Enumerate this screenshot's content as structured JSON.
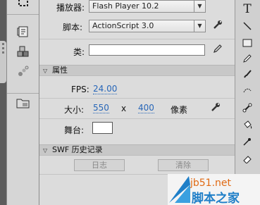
{
  "properties": {
    "player_label": "播放器:",
    "player_value": "Flash Player 10.2",
    "script_label": "脚本:",
    "script_value": "ActionScript 3.0",
    "class_label": "类:",
    "class_value": "",
    "section_properties": "属性",
    "fps_label": "FPS:",
    "fps_value": "24.00",
    "size_label": "大小:",
    "width_value": "550",
    "size_x": "x",
    "height_value": "400",
    "size_unit": "像素",
    "stage_label": "舞台:",
    "stage_color": "#ffffff",
    "section_swf_history": "SWF 历史记录",
    "log_button": "日志",
    "clear_button": "清除"
  },
  "watermark": {
    "url": "jb51.net",
    "name": "脚本之家"
  },
  "colors": {
    "link_blue": "#2766b8",
    "panel_bg": "#dcdcdc",
    "dark_strip": "#5c5c5c"
  }
}
